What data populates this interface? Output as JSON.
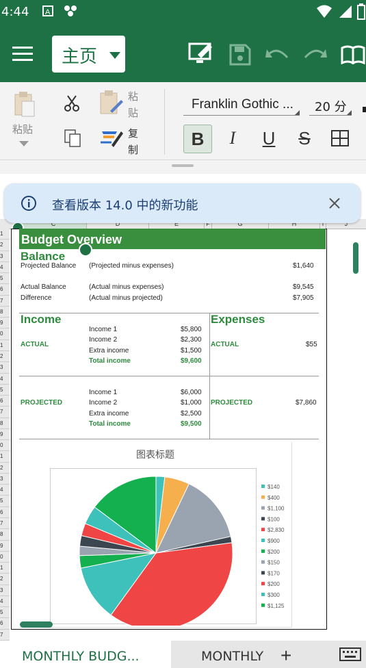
{
  "status": {
    "time": "4:44"
  },
  "appbar": {
    "home_tab": "主页"
  },
  "ribbon": {
    "paste": "粘贴",
    "paste_special_1": "粘",
    "paste_special_2": "贴",
    "copy_format_1": "复",
    "copy_format_2": "制",
    "font_name": "Franklin Gothic ...",
    "font_size": "20 分",
    "bold": "B",
    "italic": "I",
    "underline": "U",
    "strike": "S"
  },
  "notification": {
    "text": "查看版本 14.0 中的新功能"
  },
  "sheet": {
    "columns": [
      "C",
      "D",
      "E",
      "F",
      "G",
      "H",
      "I",
      "J"
    ],
    "rows": [
      "1",
      "2",
      "3",
      "4",
      "5",
      "6",
      "7",
      "8",
      "9",
      "0",
      "1",
      "2",
      "3",
      "4",
      "5",
      "6",
      "7",
      "8",
      "9",
      "0",
      "1",
      "2",
      "3",
      "4",
      "5",
      "6",
      "7",
      "8",
      "9",
      "0",
      "1",
      "2",
      "3",
      "4",
      "5",
      "6",
      "7"
    ],
    "title": "Budget Overview",
    "balance": {
      "heading": "Balance",
      "projected_label": "Projected Balance",
      "projected_desc": "(Projected  minus expenses)",
      "projected_value": "$1,640",
      "actual_label": "Actual Balance",
      "actual_desc": "(Actual  minus expenses)",
      "actual_value": "$9,545",
      "diff_label": "Difference",
      "diff_desc": "(Actual minus projected)",
      "diff_value": "$7,905"
    },
    "income": {
      "heading": "Income",
      "actual_label": "ACTUAL",
      "projected_label": "PROJECTED",
      "actual_items": [
        {
          "label": "Income 1",
          "value": "$5,800"
        },
        {
          "label": "Income 2",
          "value": "$2,300"
        },
        {
          "label": "Extra income",
          "value": "$1,500"
        },
        {
          "label": "Total income",
          "value": "$9,600"
        }
      ],
      "projected_items": [
        {
          "label": "Income 1",
          "value": "$6,000"
        },
        {
          "label": "Income 2",
          "value": "$1,000"
        },
        {
          "label": "Extra income",
          "value": "$2,500"
        },
        {
          "label": "Total income",
          "value": "$9,500"
        }
      ]
    },
    "expenses": {
      "heading": "Expenses",
      "actual_label": "ACTUAL",
      "actual_value": "$55",
      "projected_label": "PROJECTED",
      "projected_value": "$7,860"
    }
  },
  "chart_data": {
    "type": "pie",
    "title": "图表标题",
    "categories": [
      "$140",
      "$400",
      "$1,100",
      "$100",
      "$2,830",
      "$900",
      "$200",
      "$150",
      "$170",
      "$200",
      "$300",
      "$1,125"
    ],
    "values": [
      140,
      400,
      1100,
      100,
      2830,
      900,
      200,
      150,
      170,
      200,
      300,
      1125
    ],
    "colors": [
      "#3fc1bb",
      "#f5b04d",
      "#9aa3b0",
      "#3c4650",
      "#f04545",
      "#3fc1bb",
      "#14b050",
      "#9aa3b0",
      "#3c4650",
      "#f04545",
      "#3fc1bb",
      "#14b050"
    ],
    "legend": "right"
  },
  "tabs": {
    "tab1": "MONTHLY BUDG...",
    "tab2": "MONTHLY",
    "add": "+"
  },
  "colors": {
    "brand": "#1e7145",
    "accent_green": "#2e8b3e"
  }
}
